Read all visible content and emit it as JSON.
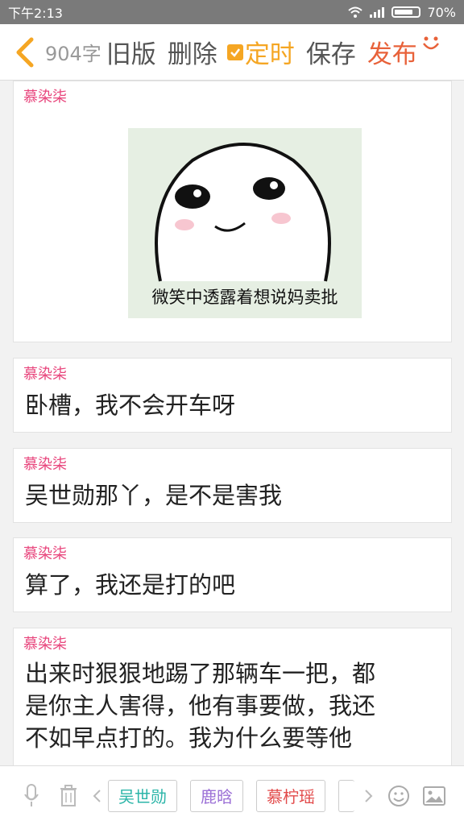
{
  "status": {
    "time": "下午2:13",
    "battery": "70%"
  },
  "toolbar": {
    "word_count": "904字",
    "old_version": "旧版",
    "delete": "删除",
    "timer": "定时",
    "save": "保存",
    "publish": "发布"
  },
  "feed": [
    {
      "speaker": "慕染柒",
      "type": "image",
      "caption": "微笑中透露着想说妈卖批"
    },
    {
      "speaker": "慕染柒",
      "type": "text",
      "text": "卧槽，我不会开车呀"
    },
    {
      "speaker": "慕染柒",
      "type": "text",
      "text": "吴世勋那丫，是不是害我"
    },
    {
      "speaker": "慕染柒",
      "type": "text",
      "text": "算了，我还是打的吧"
    },
    {
      "speaker": "慕染柒",
      "type": "text",
      "lines": [
        "出来时狠狠地踢了那辆车一把，都",
        "是你主人害得，他有事要做，我还",
        "不如早点打的。我为什么要等他"
      ]
    }
  ],
  "characters": [
    {
      "name": "吴世勋",
      "color": "#2bb5a8"
    },
    {
      "name": "鹿晗",
      "color": "#9b6fd6"
    },
    {
      "name": "慕柠瑶",
      "color": "#e24a4a"
    }
  ],
  "colors": {
    "accent_orange": "#f5a623",
    "publish_red": "#e8623a",
    "speaker_pink": "#e8457c"
  }
}
